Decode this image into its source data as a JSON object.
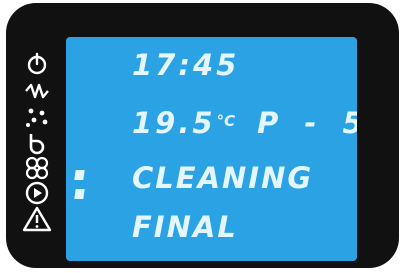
{
  "display": {
    "time": "17:45",
    "temperature": "19.5",
    "temperature_unit": "°C",
    "program": "P - 5",
    "status": "CLEANING",
    "phase": "FINAL"
  },
  "icons": [
    "power-icon",
    "lightning-icon",
    "sparkle-icon",
    "spin-icon",
    "fan-icon",
    "play-icon",
    "warning-icon"
  ],
  "colors": {
    "lcd_background": "#2aa2e4",
    "segment_text": "#e4f6ff",
    "bezel": "#111111",
    "icon": "#ffffff"
  }
}
